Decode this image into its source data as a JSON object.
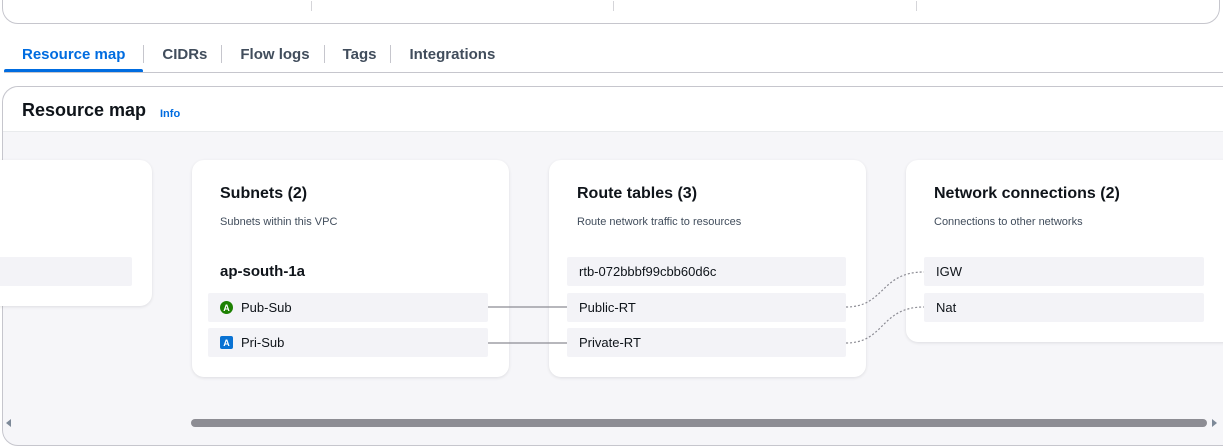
{
  "tabs": [
    {
      "label": "Resource map",
      "active": true
    },
    {
      "label": "CIDRs"
    },
    {
      "label": "Flow logs"
    },
    {
      "label": "Tags"
    },
    {
      "label": "Integrations"
    }
  ],
  "resource_map": {
    "title": "Resource map",
    "info": "Info"
  },
  "subnets": {
    "title": "Subnets (2)",
    "subtitle": "Subnets within this VPC",
    "az": "ap-south-1a",
    "items": [
      {
        "label": "Pub-Sub",
        "badge": "A",
        "icon": "public-subnet-icon",
        "color": "#1d8102"
      },
      {
        "label": "Pri-Sub",
        "badge": "A",
        "icon": "private-subnet-icon",
        "color": "#0972d3"
      }
    ]
  },
  "route_tables": {
    "title": "Route tables (3)",
    "subtitle": "Route network traffic to resources",
    "items": [
      {
        "label": "rtb-072bbbf99cbb60d6c"
      },
      {
        "label": "Public-RT"
      },
      {
        "label": "Private-RT"
      }
    ]
  },
  "network_connections": {
    "title": "Network connections (2)",
    "subtitle": "Connections to other networks",
    "items": [
      {
        "label": "IGW"
      },
      {
        "label": "Nat"
      }
    ]
  },
  "colors": {
    "accent": "#006ce0",
    "connector": "#8c8c94"
  }
}
